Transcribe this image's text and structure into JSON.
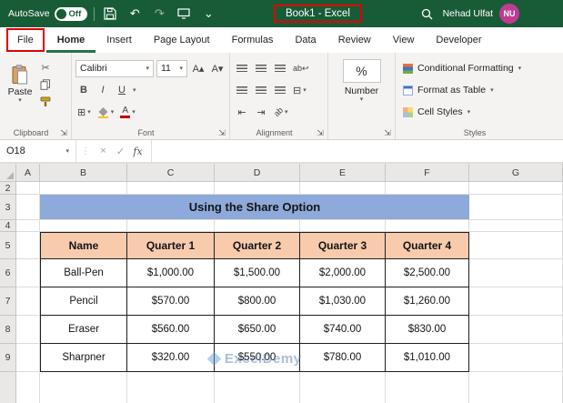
{
  "colors": {
    "titlebar": "#185C37",
    "accent": "#217346",
    "annotation": "#E00000",
    "avatar": "#C03B93",
    "banner_fill": "#8EAADB",
    "table_header_fill": "#F8CBAD"
  },
  "title_bar": {
    "autosave_label": "AutoSave",
    "autosave_state": "Off",
    "title": "Book1 - Excel",
    "user_name": "Nehad Ulfat",
    "user_initials": "NU"
  },
  "tabs": {
    "file": "File",
    "home": "Home",
    "insert": "Insert",
    "page_layout": "Page Layout",
    "formulas": "Formulas",
    "data": "Data",
    "review": "Review",
    "view": "View",
    "developer": "Developer"
  },
  "ribbon": {
    "paste": "Paste",
    "font_name": "Calibri",
    "font_size": "11",
    "bold": "B",
    "italic": "I",
    "underline": "U",
    "number_percent": "%",
    "number_format": "Number",
    "styles_items": {
      "conditional": "Conditional Formatting",
      "format_table": "Format as Table",
      "cell_styles": "Cell Styles"
    },
    "group_labels": {
      "clipboard": "Clipboard",
      "font": "Font",
      "alignment": "Alignment",
      "styles": "Styles"
    }
  },
  "formula_bar": {
    "name_box": "O18",
    "fx": "fx"
  },
  "icons": {
    "caret": "▾",
    "chevron_down": "⌄",
    "undo": "↶",
    "redo": "↷",
    "scissors": "✂",
    "borders": "⊞",
    "merge": "⊟",
    "indent_decrease": "⇤",
    "indent_increase": "⇥",
    "wrap": "ab↩",
    "orientation": "ab",
    "close": "×",
    "check": "✓",
    "dots": "⋮",
    "dialog_launcher": "⇲",
    "font_increase": "A▴",
    "font_decrease": "A▾",
    "font_color_letter": "A"
  },
  "sheet": {
    "column_headers": [
      "A",
      "B",
      "C",
      "D",
      "E",
      "F",
      "G"
    ],
    "row_headers": [
      "2",
      "3",
      "4",
      "5",
      "6",
      "7",
      "8",
      "9"
    ],
    "banner_title": "Using the Share Option",
    "table": {
      "headers": [
        "Name",
        "Quarter 1",
        "Quarter 2",
        "Quarter 3",
        "Quarter 4"
      ],
      "rows": [
        [
          "Ball-Pen",
          "$1,000.00",
          "$1,500.00",
          "$2,000.00",
          "$2,500.00"
        ],
        [
          "Pencil",
          "$570.00",
          "$800.00",
          "$1,030.00",
          "$1,260.00"
        ],
        [
          "Eraser",
          "$560.00",
          "$650.00",
          "$740.00",
          "$830.00"
        ],
        [
          "Sharpner",
          "$320.00",
          "$550.00",
          "$780.00",
          "$1,010.00"
        ]
      ]
    },
    "watermark": "ExcelDemy"
  }
}
